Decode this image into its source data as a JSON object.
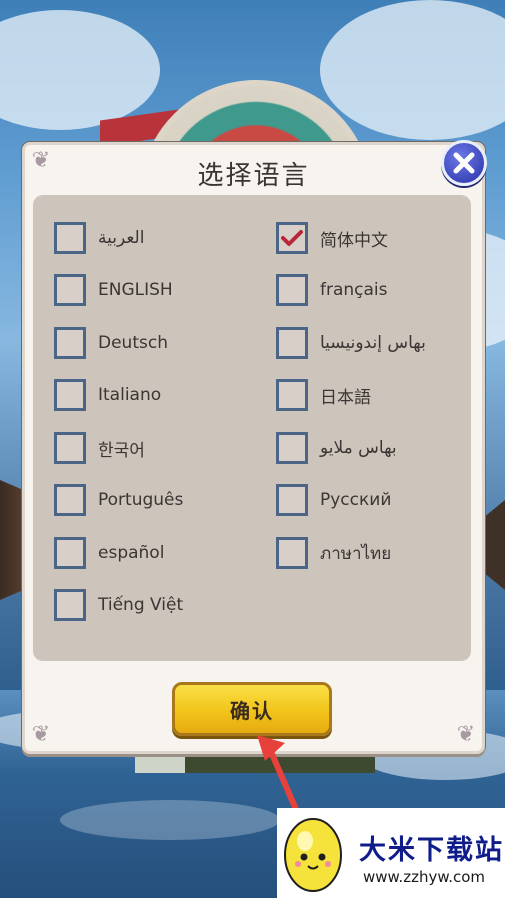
{
  "dialog": {
    "title": "选择语言",
    "confirm_label": "确认"
  },
  "options": {
    "left": [
      {
        "label": "العربية",
        "checked": false
      },
      {
        "label": "ENGLISH",
        "checked": false
      },
      {
        "label": "Deutsch",
        "checked": false
      },
      {
        "label": "Italiano",
        "checked": false
      },
      {
        "label": "한국어",
        "checked": false
      },
      {
        "label": "Português",
        "checked": false
      },
      {
        "label": "español",
        "checked": false
      },
      {
        "label": "Tiếng Việt",
        "checked": false
      }
    ],
    "right": [
      {
        "label": "简体中文",
        "checked": true
      },
      {
        "label": "français",
        "checked": false
      },
      {
        "label": "بهاس إندونيسيا",
        "checked": false
      },
      {
        "label": "日本語",
        "checked": false
      },
      {
        "label": "بهاس ملايو",
        "checked": false
      },
      {
        "label": "Русский",
        "checked": false
      },
      {
        "label": "ภาษาไทย",
        "checked": false
      }
    ]
  },
  "icons": {
    "close": "close-icon",
    "check": "check-icon",
    "arrow": "pointer-arrow-icon",
    "logo": "egg-mascot-logo"
  },
  "colors": {
    "confirm_button": "#f2c41b",
    "close_button": "#3c46b8",
    "checkbox_border": "#4b6587",
    "check_mark": "#b8283a",
    "arrow": "#e8413b"
  },
  "watermark": {
    "title": "大米下载站",
    "url": "www.zzhyw.com"
  }
}
